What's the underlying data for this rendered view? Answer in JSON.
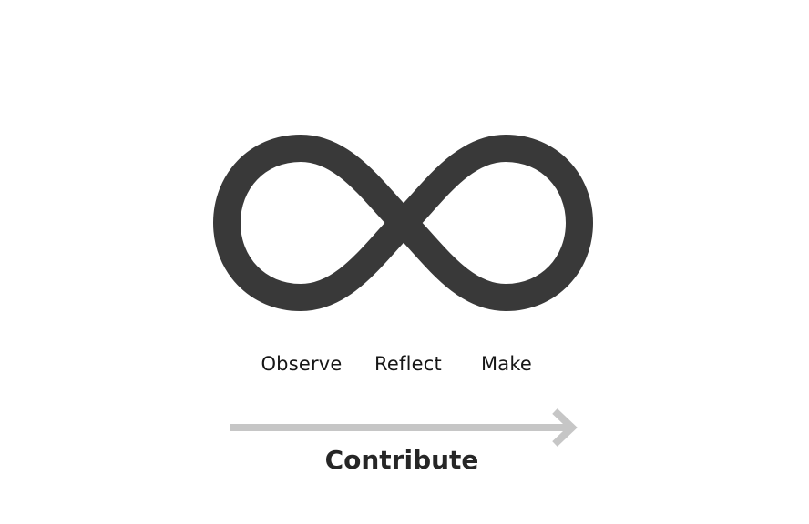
{
  "diagram": {
    "stages": [
      "Observe",
      "Reflect",
      "Make"
    ],
    "flow_label": "Contribute",
    "colors": {
      "loop": "#393939",
      "arrow": "#c6c6c6",
      "label_text": "#161616",
      "flow_text": "#262626",
      "background": "#ffffff"
    },
    "icons": {
      "loop": "infinity-loop-icon",
      "arrow": "right-arrow-icon"
    }
  }
}
